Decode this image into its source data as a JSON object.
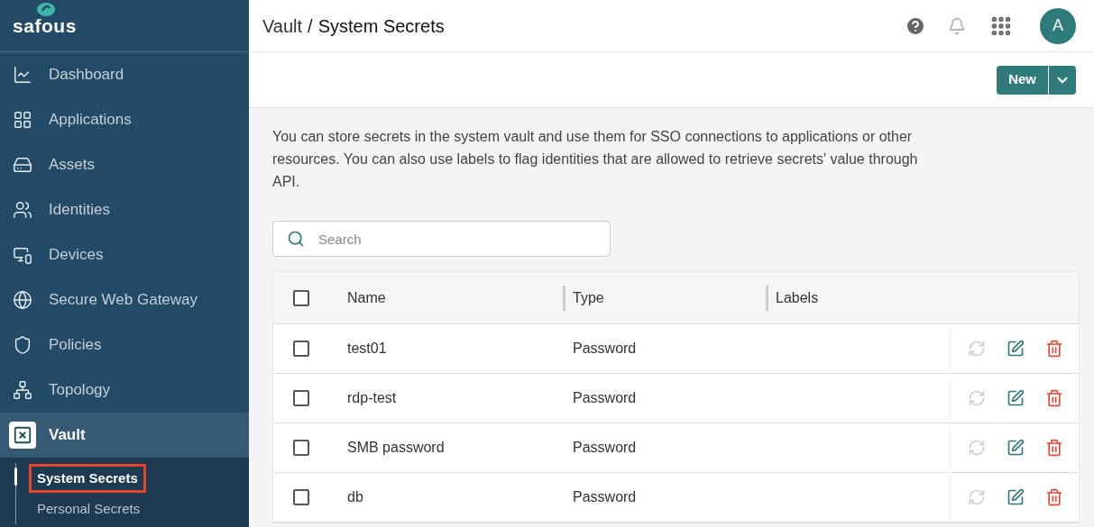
{
  "logo": {
    "text": "safous"
  },
  "sidebar": {
    "items": [
      {
        "label": "Dashboard",
        "kind": "dashboard",
        "selected": false
      },
      {
        "label": "Applications",
        "kind": "applications",
        "selected": false
      },
      {
        "label": "Assets",
        "kind": "assets",
        "selected": false
      },
      {
        "label": "Identities",
        "kind": "identities",
        "selected": false
      },
      {
        "label": "Devices",
        "kind": "devices",
        "selected": false
      },
      {
        "label": "Secure Web Gateway",
        "kind": "gateway",
        "selected": false
      },
      {
        "label": "Policies",
        "kind": "policies",
        "selected": false
      },
      {
        "label": "Topology",
        "kind": "topology",
        "selected": false
      },
      {
        "label": "Vault",
        "kind": "vault",
        "selected": true,
        "children": [
          {
            "label": "System Secrets",
            "selected": true
          },
          {
            "label": "Personal Secrets",
            "selected": false
          }
        ]
      }
    ]
  },
  "header": {
    "breadcrumb": [
      "Vault",
      "System Secrets"
    ],
    "breadcrumb_separator": "/",
    "avatar": "A"
  },
  "toolbar": {
    "new_button": "New"
  },
  "description": "You can store secrets in the system vault and use them for SSO connections to applications or other resources. You can also use labels to flag identities that are allowed to retrieve secrets' value through API.",
  "search": {
    "placeholder": "Search"
  },
  "table": {
    "select_all": {
      "checked": false
    },
    "columns": [
      "Name",
      "Type",
      "Labels"
    ],
    "rows": [
      {
        "name": "test01",
        "type": "Password",
        "checked": false
      },
      {
        "name": "rdp-test",
        "type": "Password",
        "checked": false
      },
      {
        "name": "SMB password",
        "type": "Password",
        "checked": false
      },
      {
        "name": "db",
        "type": "Password",
        "checked": false
      }
    ]
  }
}
